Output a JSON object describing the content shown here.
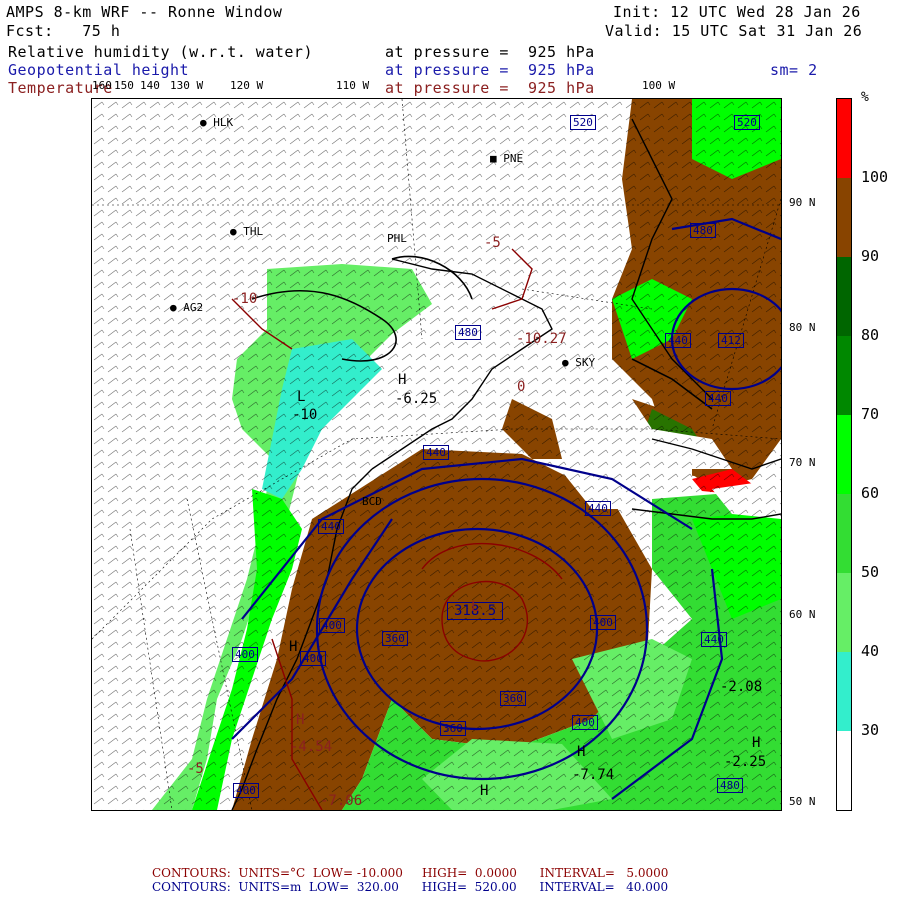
{
  "header": {
    "model": "AMPS 8-km WRF -- Ronne Window",
    "fcst": "Fcst:   75 h",
    "init": "Init: 12 UTC Wed 28 Jan 26",
    "valid": "Valid: 15 UTC Sat 31 Jan 26",
    "field1": "Relative humidity (w.r.t. water)",
    "field2": "Geopotential height",
    "field3": "Temperature",
    "pressure1": "at pressure =  925 hPa",
    "pressure2": "at pressure =  925 hPa",
    "pressure3": "at pressure =  925 hPa",
    "smoothing": "sm= 2"
  },
  "colors": {
    "rh_30_40": "#33eecc",
    "rh_40_50": "#66ee66",
    "rh_50_60": "#33dd33",
    "rh_60_70": "#00ff00",
    "rh_70_80": "#008800",
    "rh_80_90": "#006600",
    "rh_90_100": "#884400",
    "rh_100": "#ff0000",
    "height_contour": "#00008b",
    "temp_contour": "#8b0000",
    "land_fill": "#ffffff"
  },
  "colorbar": {
    "unit": "%",
    "ticks": [
      "100",
      "90",
      "80",
      "70",
      "60",
      "50",
      "40",
      "30"
    ],
    "segments": [
      {
        "range": "100+",
        "color": "#ff0000"
      },
      {
        "range": "90-100",
        "color": "#884400"
      },
      {
        "range": "80-90",
        "color": "#006600"
      },
      {
        "range": "70-80",
        "color": "#008800"
      },
      {
        "range": "60-70",
        "color": "#00ff00"
      },
      {
        "range": "50-60",
        "color": "#33dd33"
      },
      {
        "range": "40-50",
        "color": "#66ee66"
      },
      {
        "range": "30-40",
        "color": "#33eecc"
      },
      {
        "range": "<30",
        "color": "#ffffff"
      }
    ]
  },
  "longitude_labels": [
    "160",
    "150",
    "140",
    "130 W",
    "120 W",
    "110 W",
    "100 W"
  ],
  "latitude_labels": [
    "90 N",
    "80 N",
    "70 N",
    "60 N",
    "50 N"
  ],
  "stations": [
    {
      "id": "HLK"
    },
    {
      "id": "PNE"
    },
    {
      "id": "THL"
    },
    {
      "id": "PHL"
    },
    {
      "id": "AG2"
    },
    {
      "id": "SKY"
    },
    {
      "id": "BCD"
    }
  ],
  "height_labels": [
    "520",
    "520",
    "480",
    "480",
    "440",
    "440",
    "412",
    "440",
    "440",
    "440",
    "400",
    "400",
    "400",
    "400",
    "360",
    "360",
    "360",
    "318.5",
    "440",
    "400",
    "480",
    "400"
  ],
  "temp_labels": [
    "-5",
    "-10",
    "-10.27",
    "0",
    "-6.25",
    "-10",
    "-2.08",
    "-4.54",
    "-7.74",
    "-5",
    "-2.25",
    "-7.06"
  ],
  "extrema": [
    "H",
    "L",
    "H",
    "H",
    "H",
    "H",
    "H",
    "L"
  ],
  "footer": {
    "line1": "CONTOURS:  UNITS=°C  LOW= -10.000     HIGH=  0.0000      INTERVAL=   5.0000",
    "line2": "CONTOURS:  UNITS=m  LOW=  320.00      HIGH=  520.00      INTERVAL=   40.000"
  }
}
